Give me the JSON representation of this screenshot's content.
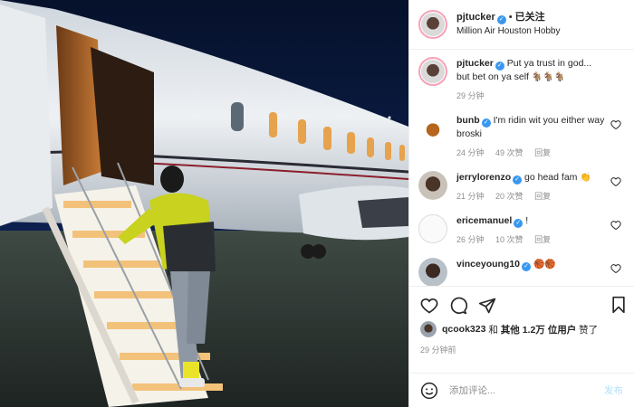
{
  "post": {
    "username": "pjtucker",
    "dot": "•",
    "follow_label": "已关注",
    "location": "Million Air Houston Hobby"
  },
  "caption": {
    "username": "pjtucker",
    "text": "Put ya trust in god... but bet on ya self",
    "emojis": "🐐🐐🐐",
    "time": "29 分钟"
  },
  "comments": [
    {
      "username": "bunb",
      "text": "I'm ridin wit you either way broski",
      "time": "24 分钟",
      "likes": "49 次赞",
      "reply": "回复",
      "verified": true
    },
    {
      "username": "jerrylorenzo",
      "text": "go head fam",
      "emoji": "👏",
      "time": "21 分钟",
      "likes": "20 次赞",
      "reply": "回复",
      "verified": true
    },
    {
      "username": "ericemanuel",
      "text": "!",
      "time": "26 分钟",
      "likes": "10 次赞",
      "reply": "回复",
      "verified": true
    },
    {
      "username": "vinceyoung10",
      "text": "",
      "emoji": "🏀🏀",
      "verified": true
    }
  ],
  "actions": {
    "icons": [
      "heart-icon",
      "comment-icon",
      "share-icon",
      "bookmark-icon"
    ]
  },
  "likes": {
    "user": "qcook323",
    "and": "和",
    "others": "其他 1.2万 位用户",
    "suffix": "赞了"
  },
  "post_time": "29 分钟前",
  "add_comment": {
    "placeholder": "添加评论...",
    "post_label": "发布"
  },
  "colors": {
    "verified": "#3897f0",
    "link_disabled": "#b2dffc",
    "muted": "#8e8e8e"
  }
}
